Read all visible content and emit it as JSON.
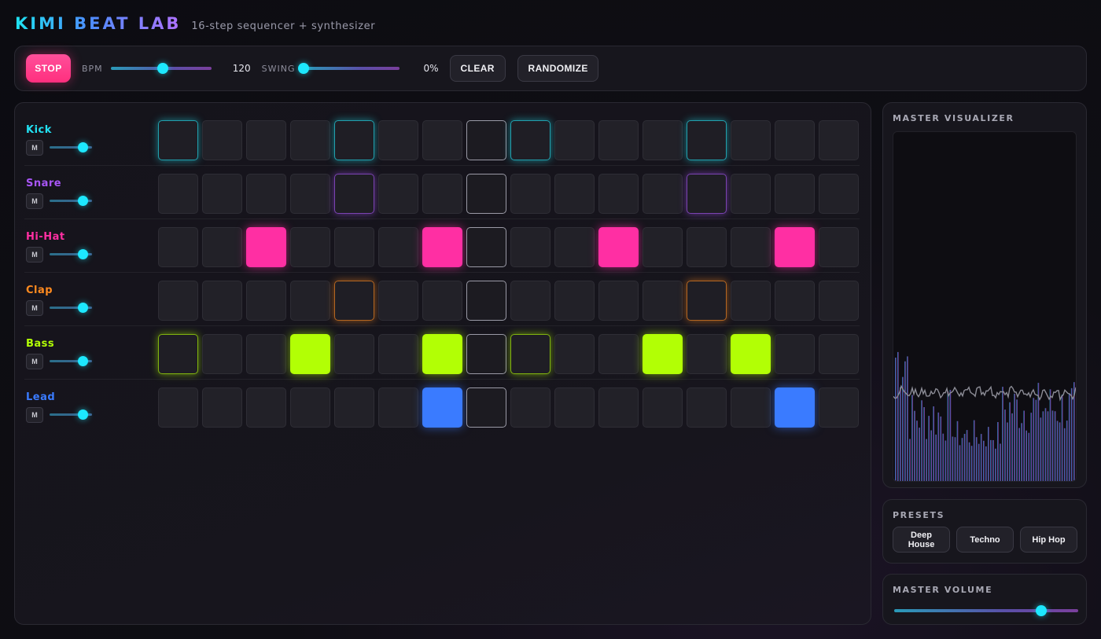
{
  "app": {
    "title": "KIMI BEAT LAB",
    "subtitle": "16-step sequencer + synthesizer"
  },
  "toolbar": {
    "stop_label": "STOP",
    "bpm_label": "BPM",
    "bpm_value": "120",
    "bpm_level": 0.52,
    "swing_label": "SWING",
    "swing_value": "0%",
    "swing_level": 0.0,
    "clear_label": "CLEAR",
    "randomize_label": "RANDOMIZE"
  },
  "sequencer": {
    "playhead_step": 7,
    "tracks": [
      {
        "name": "Kick",
        "color": "#22e1f2",
        "volume": 0.8,
        "mute_label": "M",
        "steps": [
          2,
          0,
          0,
          0,
          2,
          0,
          0,
          0,
          2,
          0,
          0,
          0,
          2,
          0,
          0,
          0
        ]
      },
      {
        "name": "Snare",
        "color": "#a855f7",
        "volume": 0.8,
        "mute_label": "M",
        "steps": [
          0,
          0,
          0,
          0,
          2,
          0,
          0,
          0,
          0,
          0,
          0,
          0,
          2,
          0,
          0,
          0
        ]
      },
      {
        "name": "Hi-Hat",
        "color": "#ff2fa3",
        "volume": 0.8,
        "mute_label": "M",
        "steps": [
          0,
          0,
          1,
          0,
          0,
          0,
          1,
          0,
          0,
          0,
          1,
          0,
          0,
          0,
          1,
          0
        ]
      },
      {
        "name": "Clap",
        "color": "#ff8a1f",
        "volume": 0.8,
        "mute_label": "M",
        "steps": [
          0,
          0,
          0,
          0,
          2,
          0,
          0,
          0,
          0,
          0,
          0,
          0,
          2,
          0,
          0,
          0
        ]
      },
      {
        "name": "Bass",
        "color": "#b2ff05",
        "volume": 0.8,
        "mute_label": "M",
        "steps": [
          2,
          0,
          0,
          1,
          0,
          0,
          1,
          0,
          2,
          0,
          0,
          1,
          0,
          1,
          0,
          0
        ]
      },
      {
        "name": "Lead",
        "color": "#3a7bff",
        "volume": 0.8,
        "mute_label": "M",
        "steps": [
          0,
          0,
          0,
          0,
          0,
          0,
          1,
          0,
          0,
          0,
          0,
          0,
          0,
          0,
          1,
          0
        ]
      }
    ]
  },
  "visualizer": {
    "title": "MASTER VISUALIZER"
  },
  "presets": {
    "title": "PRESETS",
    "items": [
      "Deep House",
      "Techno",
      "Hip Hop"
    ]
  },
  "master_volume": {
    "title": "MASTER VOLUME",
    "level": 0.8
  }
}
